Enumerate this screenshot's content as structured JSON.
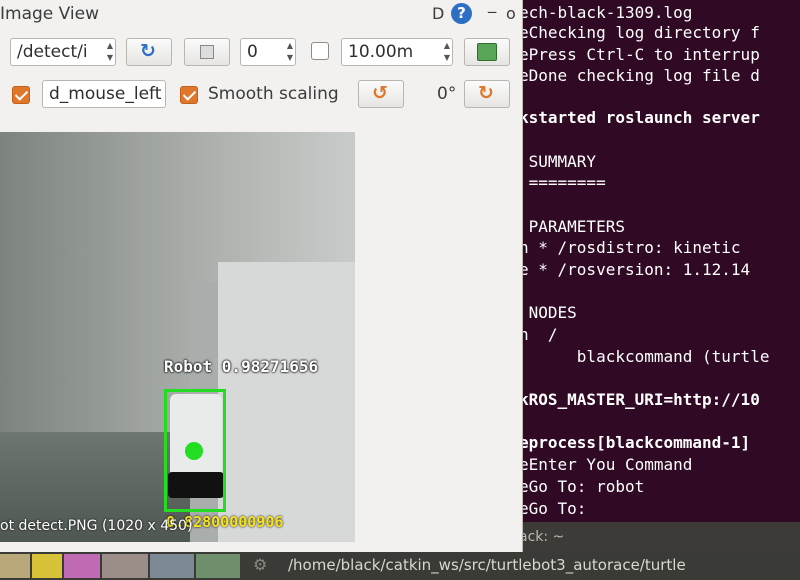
{
  "image_view": {
    "title": "Image View",
    "title_d": "D",
    "help_icon": "help-icon",
    "topic_select": "/detect/i",
    "refresh_icon": "refresh-icon",
    "save_icon": "save-icon",
    "spin_value": "0",
    "smooth_scaling_checked_left": false,
    "timeout_value": "10.00m",
    "mouse_topic": "d_mouse_left",
    "mouse_checked": true,
    "smooth_scaling_label": "Smooth scaling",
    "smooth_scaling_checked": true,
    "rotation_value": "0°",
    "rotate_icon": "rotate-icon",
    "detection": {
      "label": "Robot 0.98271656",
      "score": "0.82800000906",
      "box_color": "#22dd22"
    },
    "status_text": "ot detect.PNG (1020 x 450)"
  },
  "terminal": {
    "lines": [
      {
        "text": "ech-black-1309.log",
        "bold": false
      },
      {
        "text": "eChecking log directory f",
        "bold": false
      },
      {
        "text": "ePress Ctrl-C to interrup",
        "bold": false
      },
      {
        "text": "eDone checking log file d",
        "bold": false
      },
      {
        "text": "",
        "bold": false
      },
      {
        "text": "kstarted roslaunch server",
        "bold": true
      },
      {
        "text": "",
        "bold": false
      },
      {
        "text": " SUMMARY",
        "bold": false
      },
      {
        "text": " ========",
        "bold": false
      },
      {
        "text": "",
        "bold": false
      },
      {
        "text": " PARAMETERS",
        "bold": false
      },
      {
        "text": "h * /rosdistro: kinetic",
        "bold": false
      },
      {
        "text": "e * /rosversion: 1.12.14",
        "bold": false
      },
      {
        "text": "",
        "bold": false
      },
      {
        "text": " NODES",
        "bold": false
      },
      {
        "text": "h  /",
        "bold": false
      },
      {
        "text": "      blackcommand (turtle",
        "bold": false
      },
      {
        "text": "",
        "bold": false
      },
      {
        "text": "kROS_MASTER_URI=http://10",
        "bold": true
      },
      {
        "text": "",
        "bold": false
      },
      {
        "text": "eprocess[blackcommand-1]",
        "bold": true
      },
      {
        "text": "eEnter You Command",
        "bold": false
      },
      {
        "text": "eGo To: robot",
        "bold": false
      },
      {
        "text": "eGo To:",
        "bold": false
      }
    ],
    "titlebar": "ack: ~",
    "accent": "#300a24"
  },
  "taskbar": {
    "path": "/home/black/catkin_ws/src/turtlebot3_autorace/turtle",
    "gear_icon": "gear-icon"
  }
}
